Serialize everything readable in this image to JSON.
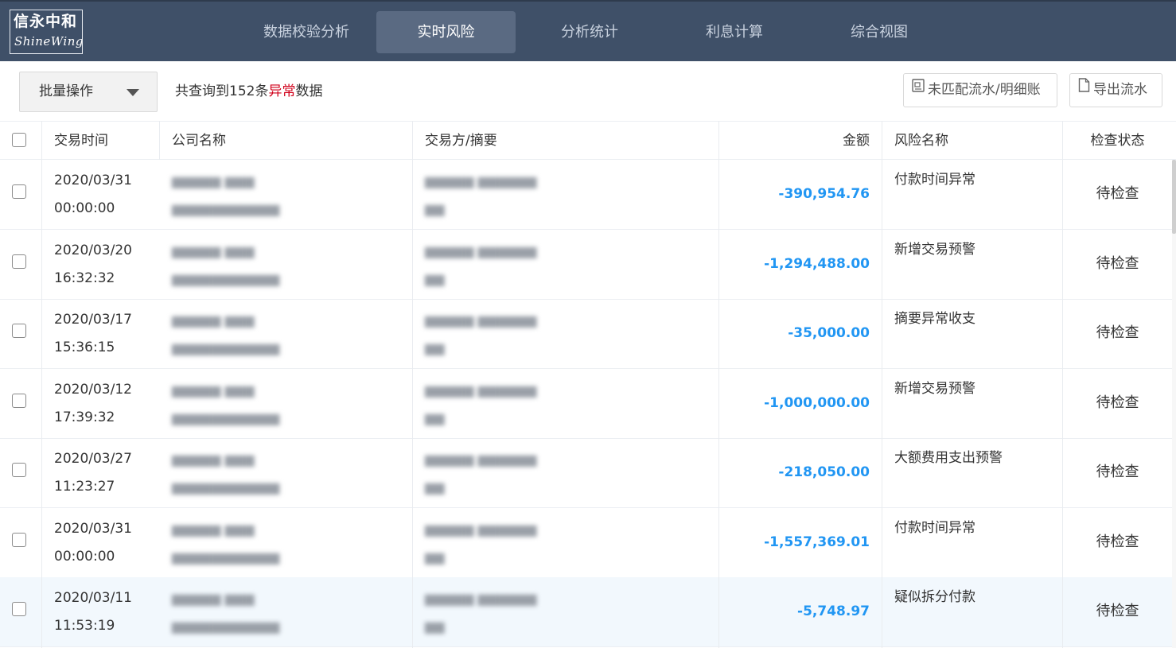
{
  "brand": {
    "cn": "信永中和",
    "en": "ShineWing"
  },
  "nav": [
    {
      "label": "数据校验分析",
      "active": false
    },
    {
      "label": "实时风险",
      "active": true
    },
    {
      "label": "分析统计",
      "active": false
    },
    {
      "label": "利息计算",
      "active": false
    },
    {
      "label": "综合视图",
      "active": false
    }
  ],
  "toolbar": {
    "batch_label": "批量操作",
    "summary_prefix": "共查询到152条",
    "summary_highlight": "异常",
    "summary_suffix": "数据",
    "unmatched_label": "未匹配流水/明细账",
    "export_label": "导出流水"
  },
  "table": {
    "headers": {
      "time": "交易时间",
      "company": "公司名称",
      "counterparty": "交易方/摘要",
      "amount": "金额",
      "risk": "风险名称",
      "status": "检查状态"
    },
    "rows": [
      {
        "date": "2020/03/31",
        "time": "00:00:00",
        "amount": "-390,954.76",
        "risk": "付款时间异常",
        "status": "待检查"
      },
      {
        "date": "2020/03/20",
        "time": "16:32:32",
        "amount": "-1,294,488.00",
        "risk": "新增交易预警",
        "status": "待检查"
      },
      {
        "date": "2020/03/17",
        "time": "15:36:15",
        "amount": "-35,000.00",
        "risk": "摘要异常收支",
        "status": "待检查"
      },
      {
        "date": "2020/03/12",
        "time": "17:39:32",
        "amount": "-1,000,000.00",
        "risk": "新增交易预警",
        "status": "待检查"
      },
      {
        "date": "2020/03/27",
        "time": "11:23:27",
        "amount": "-218,050.00",
        "risk": "大额费用支出预警",
        "status": "待检查"
      },
      {
        "date": "2020/03/31",
        "time": "00:00:00",
        "amount": "-1,557,369.01",
        "risk": "付款时间异常",
        "status": "待检查"
      },
      {
        "date": "2020/03/11",
        "time": "11:53:19",
        "amount": "-5,748.97",
        "risk": "疑似拆分付款",
        "status": "待检查"
      }
    ]
  }
}
